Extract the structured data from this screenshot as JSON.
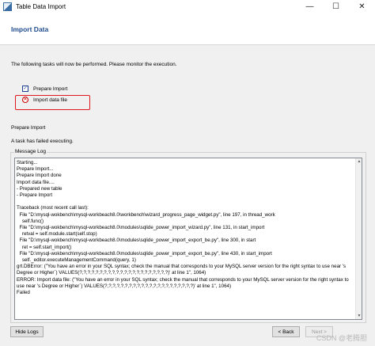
{
  "window": {
    "title": "Table Data Import",
    "minimize_icon": "minimize-icon",
    "maximize_icon": "maximize-icon",
    "close_icon": "close-icon"
  },
  "header": {
    "title": "Import Data"
  },
  "intro_text": "The following tasks will now be performed. Please monitor the execution.",
  "tasks": [
    {
      "label": "Prepare Import",
      "status": "done",
      "icon": "checkmark-icon"
    },
    {
      "label": "Import data file",
      "status": "failed",
      "icon": "error-icon"
    }
  ],
  "current_task": "Prepare Import",
  "status_text": "A task has failed executing.",
  "message_log": {
    "label": "Message Log",
    "lines": [
      "Starting...",
      "Prepare Import...",
      "Prepare Import done",
      "Import data file....",
      "- Prepared new table",
      "- Prepare Import",
      "",
      "Traceback (most recent call last):",
      "  File \"D:\\mysql-wokbench\\mysql-workbeach8.0\\workbench\\wizard_progress_page_widget.py\", line 197, in thread_work",
      "    self.func()",
      "  File \"D:\\mysql-wokbench\\mysql-workbeach8.0\\modules\\sqlide_power_import_wizard.py\", line 131, in start_import",
      "    retval = self.module.start(self.stop)",
      "  File \"D:\\mysql-wokbench\\mysql-workbeach8.0\\modules\\sqlide_power_import_export_be.py\", line 300, in start",
      "    ret = self.start_import()",
      "  File \"D:\\mysql-wokbench\\mysql-workbeach8.0\\modules\\sqlide_power_import_export_be.py\", line 430, in start_import",
      "    self._editor.executeManagementCommand(query, 1)",
      "grt.DBError: (\"You have an error in your SQL syntax; check the manual that corresponds to your MySQL server version for the right syntax to use near 's Degree or Higher`) VALUES(?,?,?,?,?,?,?,?,?,?,?,?,?,?,?,?,?,?,?,?,?,?)' at line 1\", 1064)",
      "ERROR: Import data file: (\"You have an error in your SQL syntax; check the manual that corresponds to your MySQL server version for the right syntax to use near 's Degree or Higher`) VALUES(?,?,?,?,?,?,?,?,?,?,?,?,?,?,?,?,?,?,?,?,?,?)' at line 1\", 1064)",
      "Failed"
    ]
  },
  "buttons": {
    "hide_logs": "Hide Logs",
    "back": "< Back",
    "next": "Next >"
  },
  "watermark": "CSDN @老腾胆"
}
